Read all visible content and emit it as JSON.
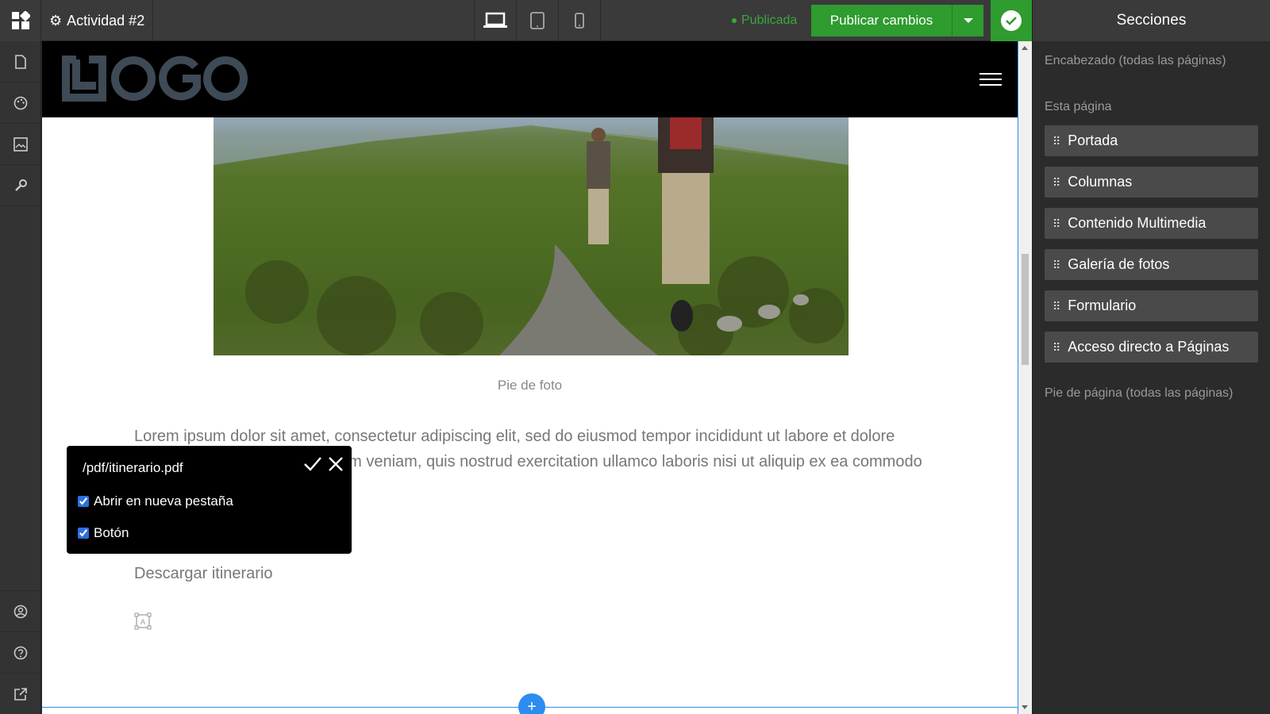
{
  "topbar": {
    "site_name": "Actividad #2",
    "status": "Publicada",
    "publish_label": "Publicar cambios"
  },
  "panel": {
    "title": "Secciones",
    "header_label": "Encabezado (todas las páginas)",
    "this_page_label": "Esta página",
    "sections": [
      {
        "label": "Portada"
      },
      {
        "label": "Columnas"
      },
      {
        "label": "Contenido Multimedia"
      },
      {
        "label": "Galería de fotos"
      },
      {
        "label": "Formulario"
      },
      {
        "label": "Acceso directo a Páginas"
      }
    ],
    "footer_label": "Pie de página (todas las páginas)"
  },
  "canvas": {
    "caption": "Pie de foto",
    "paragraph": "Lorem ipsum dolor sit amet, consectetur adipiscing elit, sed do eiusmod tempor incididunt ut labore et dolore magna aliqua. Ut enim ad minim veniam, quis nostrud exercitation ullamco laboris nisi ut aliquip ex ea commodo consequat.",
    "download_link": "Descargar itinerario",
    "add_symbol": "+"
  },
  "link_popup": {
    "url": "/pdf/itinerario.pdf",
    "new_tab_label": "Abrir en nueva pestaña",
    "new_tab_checked": true,
    "button_label": "Botón",
    "button_checked": true
  }
}
